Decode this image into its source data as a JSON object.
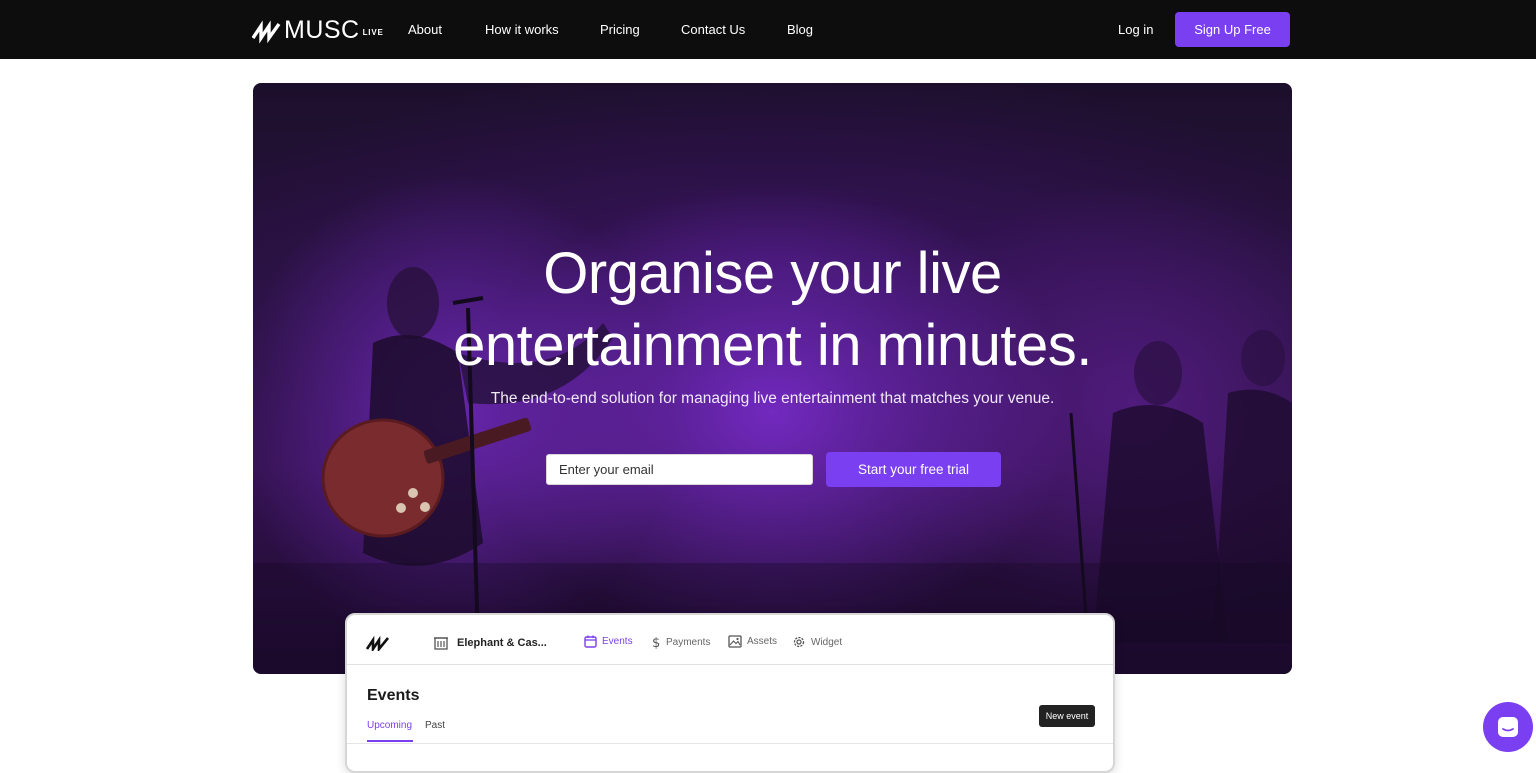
{
  "brand": {
    "wordmark": "MUSC",
    "suffix": "LIVE",
    "accent": "#7b3ff2"
  },
  "nav": {
    "links": [
      "About",
      "How it works",
      "Pricing",
      "Contact Us",
      "Blog"
    ],
    "login": "Log in",
    "signup": "Sign Up Free"
  },
  "hero": {
    "title_line1": "Organise your live",
    "title_line2": "entertainment in minutes.",
    "subtitle": "The end-to-end solution for managing live entertainment that matches your venue.",
    "email_placeholder": "Enter your email",
    "cta": "Start your free trial"
  },
  "preview": {
    "venue": "Elephant & Cas...",
    "tabs": [
      {
        "label": "Events",
        "icon": "calendar-icon",
        "active": true
      },
      {
        "label": "Payments",
        "icon": "dollar-icon",
        "active": false
      },
      {
        "label": "Assets",
        "icon": "image-icon",
        "active": false
      },
      {
        "label": "Widget",
        "icon": "gear-icon",
        "active": false
      }
    ],
    "title": "Events",
    "subtabs": [
      "Upcoming",
      "Past"
    ],
    "new_button": "New event"
  },
  "chat": {
    "icon": "chat-icon"
  }
}
